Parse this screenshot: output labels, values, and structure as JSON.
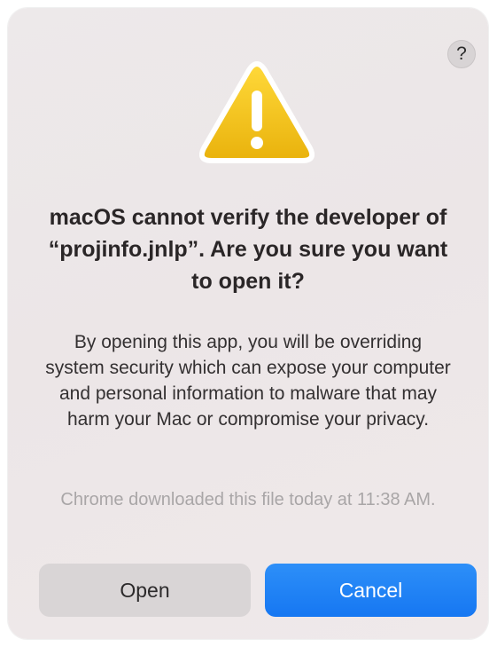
{
  "dialog": {
    "help_label": "?",
    "icon": "warning-triangle-icon",
    "title": "macOS cannot verify the developer of “projinfo.jnlp”. Are you sure you want to open it?",
    "message": "By opening this app, you will be overriding system security which can expose your computer and personal information to malware that may harm your Mac or compromise your privacy.",
    "info": "Chrome downloaded this file today at 11:38 AM.",
    "buttons": {
      "open_label": "Open",
      "cancel_label": "Cancel"
    }
  },
  "colors": {
    "accent": "#1a7cf5",
    "warning": "#f5c518"
  }
}
